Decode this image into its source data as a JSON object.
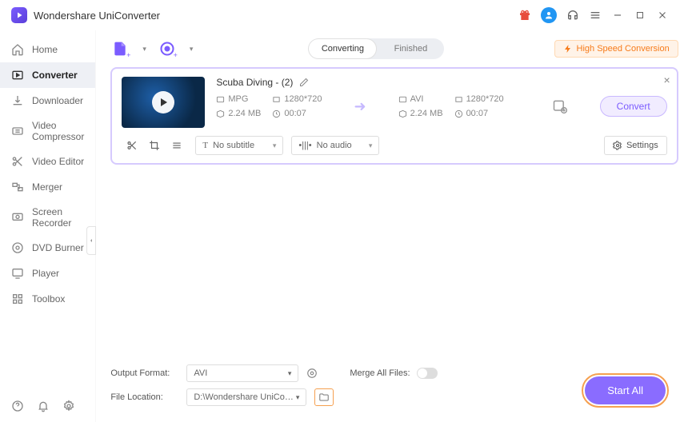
{
  "app": {
    "title": "Wondershare UniConverter"
  },
  "sidebar": {
    "items": [
      {
        "label": "Home"
      },
      {
        "label": "Converter"
      },
      {
        "label": "Downloader"
      },
      {
        "label": "Video Compressor"
      },
      {
        "label": "Video Editor"
      },
      {
        "label": "Merger"
      },
      {
        "label": "Screen Recorder"
      },
      {
        "label": "DVD Burner"
      },
      {
        "label": "Player"
      },
      {
        "label": "Toolbox"
      }
    ]
  },
  "tabs": {
    "converting": "Converting",
    "finished": "Finished"
  },
  "hsc": "High Speed Conversion",
  "item": {
    "title": "Scuba Diving - (2)",
    "src": {
      "fmt": "MPG",
      "res": "1280*720",
      "size": "2.24 MB",
      "dur": "00:07"
    },
    "dst": {
      "fmt": "AVI",
      "res": "1280*720",
      "size": "2.24 MB",
      "dur": "00:07"
    },
    "subtitle": "No subtitle",
    "audio": "No audio",
    "settings": "Settings",
    "convert": "Convert"
  },
  "bottom": {
    "output_label": "Output Format:",
    "output_value": "AVI",
    "location_label": "File Location:",
    "location_value": "D:\\Wondershare UniConverter",
    "merge_label": "Merge All Files:",
    "start_all": "Start All"
  }
}
